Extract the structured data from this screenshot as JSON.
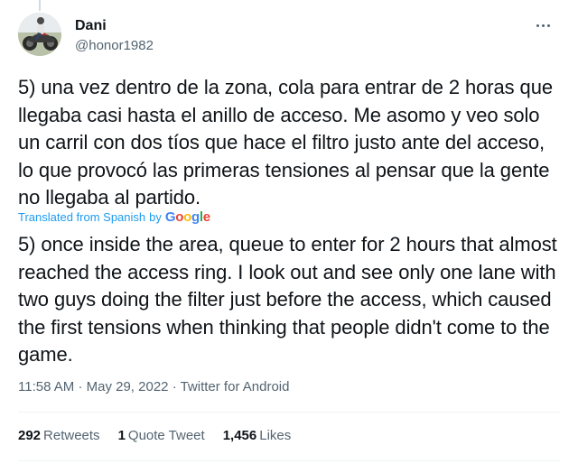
{
  "author": {
    "display_name": "Dani",
    "handle": "@honor1982"
  },
  "icons": {
    "more": "more-horizontal-icon",
    "avatar": "motorcycle-rider-photo"
  },
  "tweet": {
    "text": "5) una vez dentro de la zona, cola para entrar de 2 horas que llegaba casi hasta el anillo de acceso. Me asomo y veo solo un carril con dos tíos que hace el filtro justo ante del acceso, lo que provocó las primeras tensiones al pensar que la gente no llegaba al partido.",
    "translated_label": "Translated from Spanish",
    "translated_by": "by",
    "google_letters": [
      "G",
      "o",
      "o",
      "g",
      "l",
      "e"
    ],
    "translation": "5) once inside the area, queue to enter for 2 hours that almost reached the access ring. I look out and see only one lane with two guys doing the filter just before the access, which caused the first tensions when thinking that people didn't come to the game."
  },
  "meta": {
    "time": "11:58 AM",
    "separator": "·",
    "date": "May 29, 2022",
    "source": "Twitter for Android"
  },
  "stats": {
    "retweets_count": "292",
    "retweets_label": "Retweets",
    "quotes_count": "1",
    "quotes_label": "Quote Tweet",
    "likes_count": "1,456",
    "likes_label": "Likes"
  },
  "colors": {
    "link_blue": "#1d9bf0",
    "secondary_text": "#536471",
    "primary_text": "#0f1419",
    "divider": "#eff3f4"
  }
}
